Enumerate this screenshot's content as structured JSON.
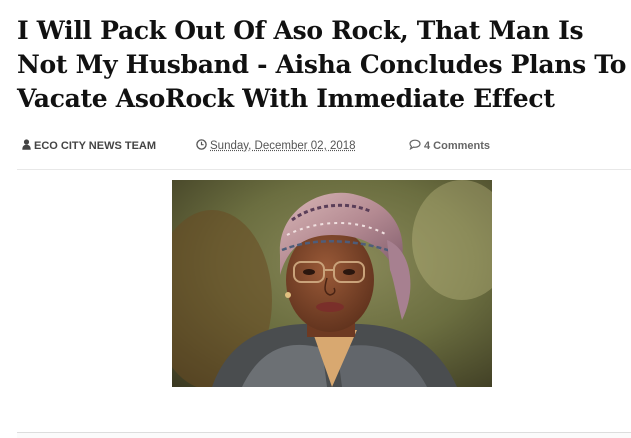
{
  "article": {
    "title": "I Will Pack Out Of Aso Rock, That Man Is Not My Husband - Aisha Concludes Plans To Vacate AsoRock With Immediate Effect",
    "author": "ECO CITY NEWS TEAM",
    "date": "Sunday, December 02, 2018",
    "comments": "4 Comments",
    "icons": {
      "author": "user-icon",
      "date": "clock-icon",
      "comments": "comment-bubble-icon"
    }
  }
}
